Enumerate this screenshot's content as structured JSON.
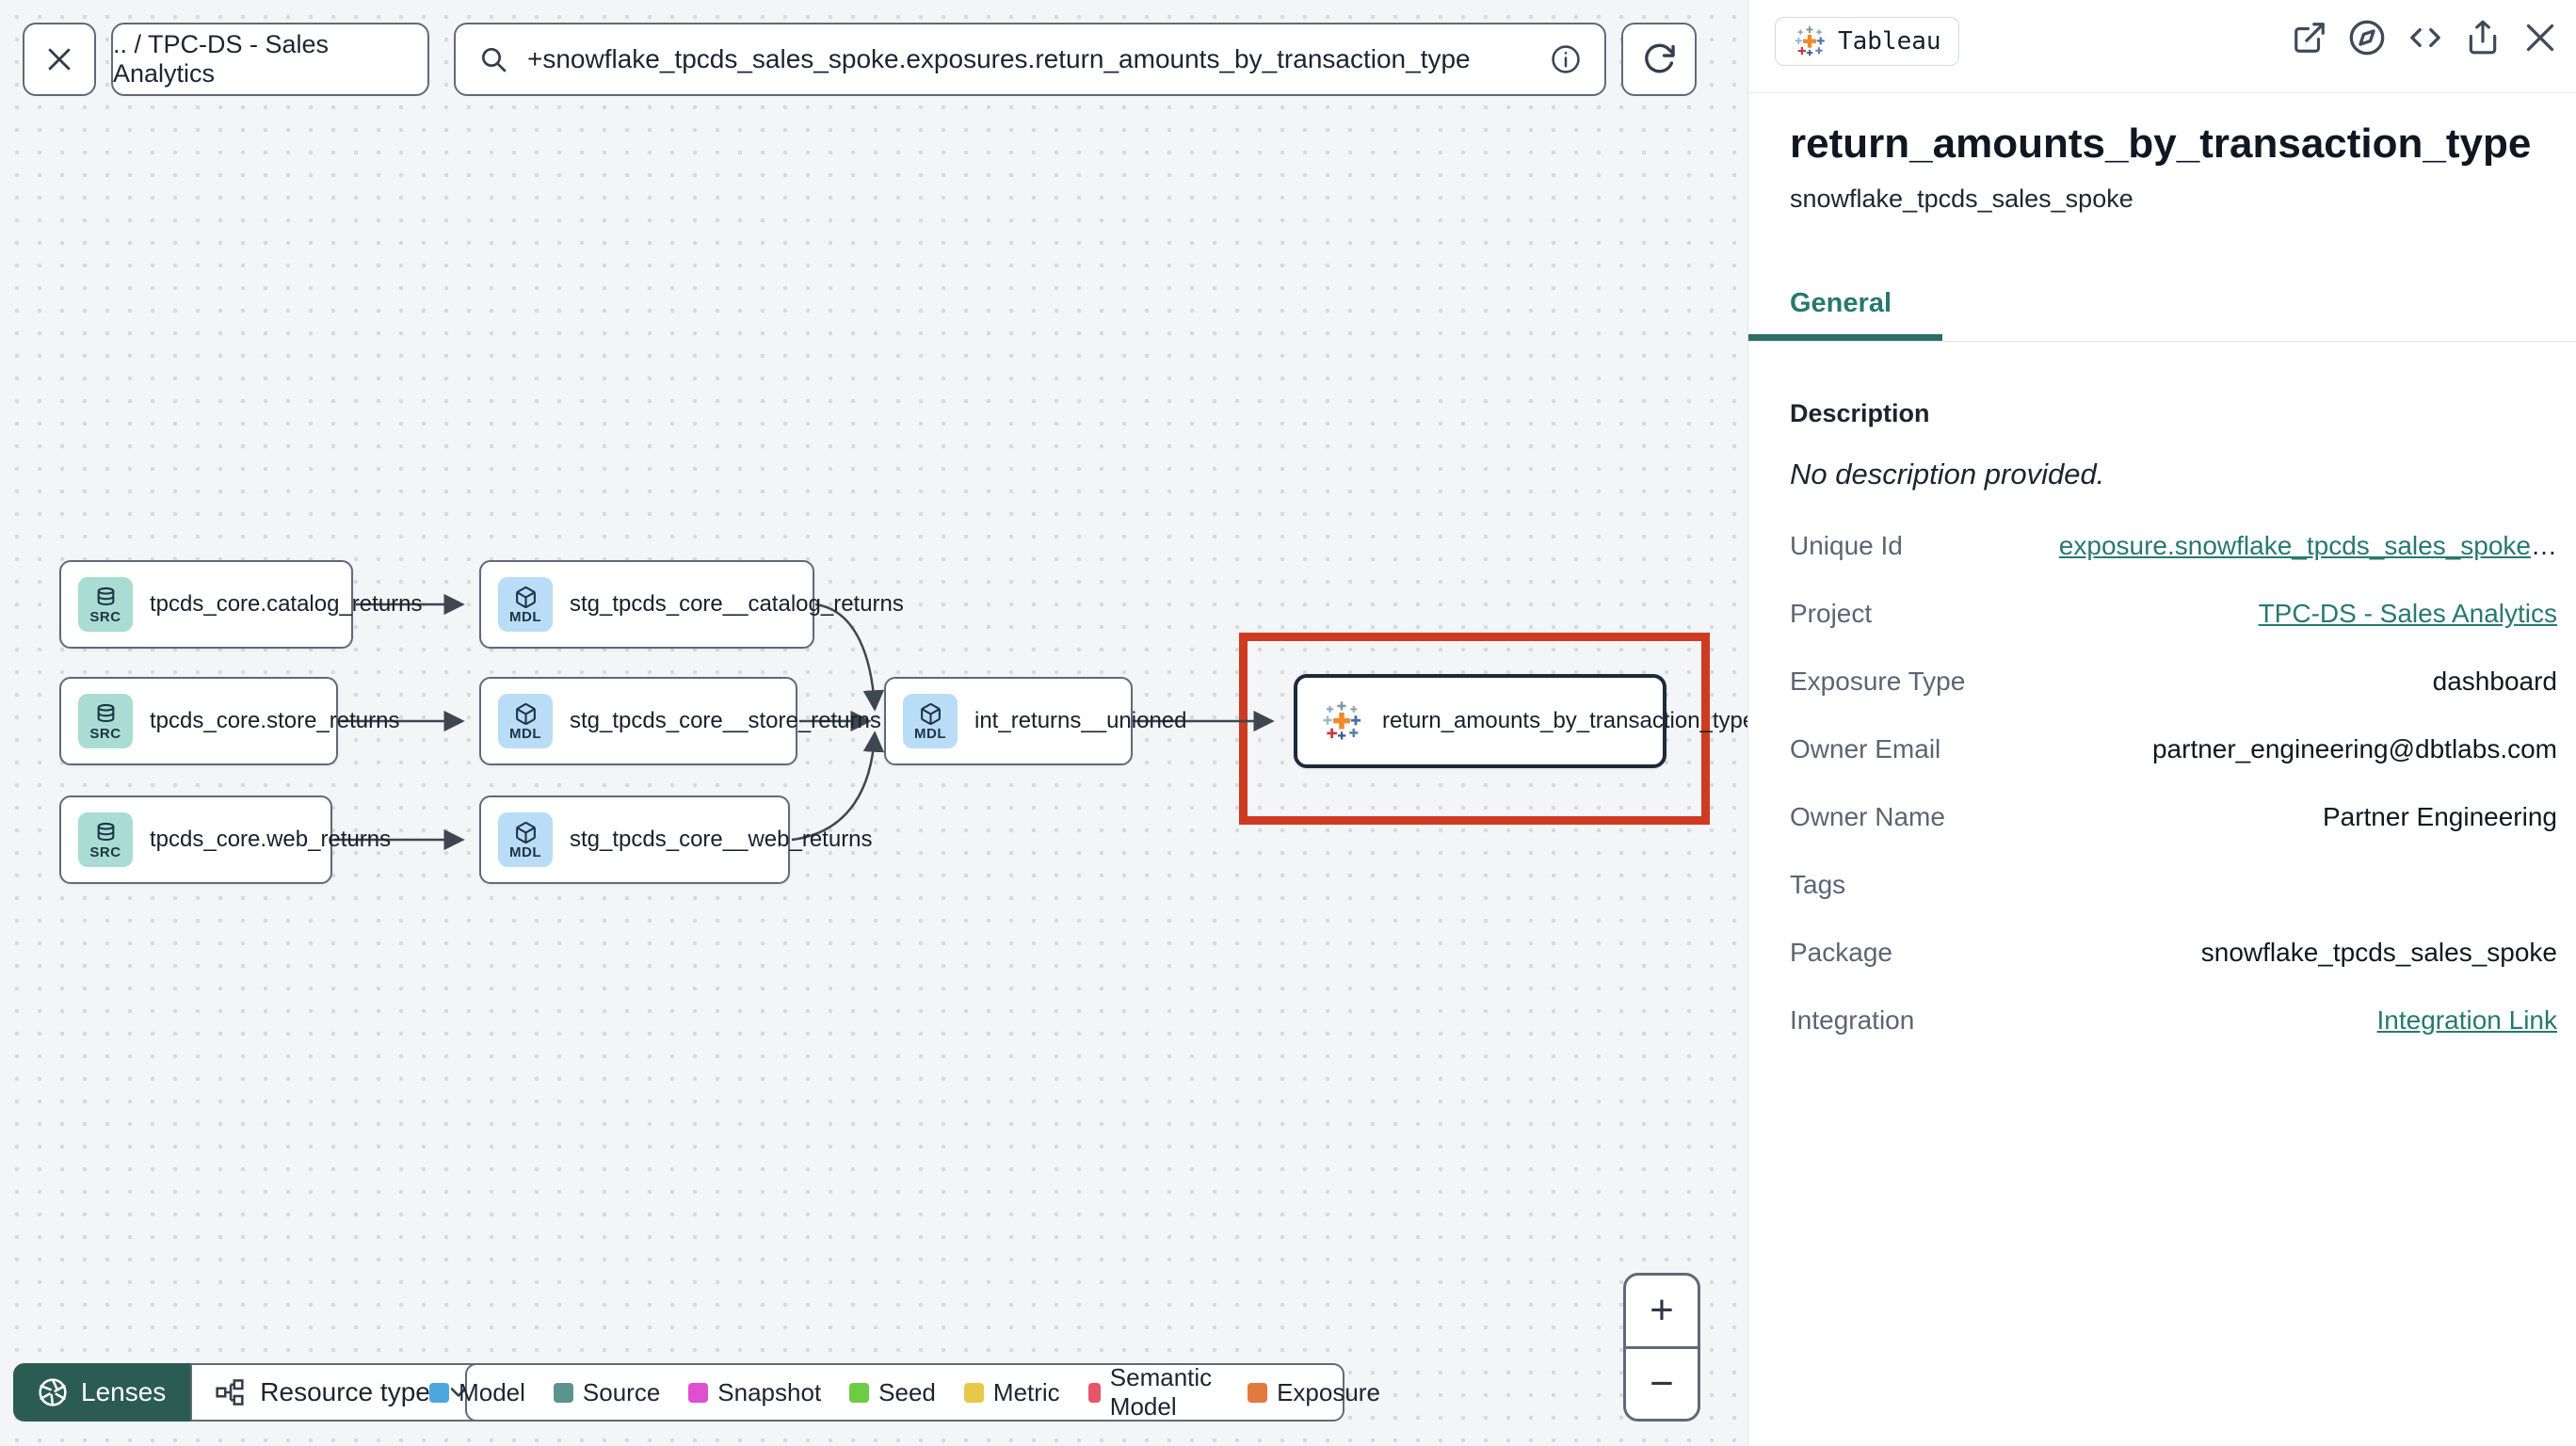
{
  "toolbar": {
    "close_label": "✕",
    "breadcrumb": ".. / TPC-DS - Sales Analytics",
    "search_value": "+snowflake_tpcds_sales_spoke.exposures.return_amounts_by_transaction_type",
    "icons": [
      "search-icon",
      "info-icon",
      "refresh-icon"
    ]
  },
  "graph": {
    "nodes": [
      {
        "type": "source",
        "badge": "SRC",
        "label": "tpcds_core.catalog_returns"
      },
      {
        "type": "source",
        "badge": "SRC",
        "label": "tpcds_core.store_returns"
      },
      {
        "type": "source",
        "badge": "SRC",
        "label": "tpcds_core.web_returns"
      },
      {
        "type": "model",
        "badge": "MDL",
        "label": "stg_tpcds_core__catalog_returns"
      },
      {
        "type": "model",
        "badge": "MDL",
        "label": "stg_tpcds_core__store_returns"
      },
      {
        "type": "model",
        "badge": "MDL",
        "label": "stg_tpcds_core__web_returns"
      },
      {
        "type": "model",
        "badge": "MDL",
        "label": "int_returns__unioned"
      },
      {
        "type": "exposure",
        "badge": "tableau-logo",
        "label": "return_amounts_by_transaction_type",
        "selected": true
      }
    ],
    "highlight_color": "#ce3b22"
  },
  "controls": {
    "lenses_label": "Lenses",
    "resource_type_label": "Resource type",
    "zoom_in": "+",
    "zoom_out": "−"
  },
  "legend": {
    "items": [
      {
        "label": "Model",
        "color": "#4da6e0"
      },
      {
        "label": "Source",
        "color": "#5b948f"
      },
      {
        "label": "Snapshot",
        "color": "#e04fd1"
      },
      {
        "label": "Seed",
        "color": "#6ccc44"
      },
      {
        "label": "Metric",
        "color": "#e8c84a"
      },
      {
        "label": "Semantic Model",
        "color": "#e5566b"
      },
      {
        "label": "Exposure",
        "color": "#e2793f"
      }
    ]
  },
  "panel": {
    "integration_chip": "Tableau",
    "header_icons": [
      "open-in-new-icon",
      "compass-icon",
      "code-icon",
      "share-icon",
      "close-icon"
    ],
    "title": "return_amounts_by_transaction_type",
    "subtitle": "snowflake_tpcds_sales_spoke",
    "tabs": [
      {
        "label": "General",
        "active": true
      }
    ],
    "accent_color": "#27796e",
    "description_heading": "Description",
    "description_empty": "No description provided.",
    "fields": [
      {
        "label": "Unique Id",
        "value": "exposure.snowflake_tpcds_sales_spoke",
        "ellipsis": "…",
        "link": true
      },
      {
        "label": "Project",
        "value": "TPC-DS - Sales Analytics",
        "link": true
      },
      {
        "label": "Exposure Type",
        "value": "dashboard"
      },
      {
        "label": "Owner Email",
        "value": "partner_engineering@dbtlabs.com"
      },
      {
        "label": "Owner Name",
        "value": "Partner Engineering"
      },
      {
        "label": "Tags",
        "value": ""
      },
      {
        "label": "Package",
        "value": "snowflake_tpcds_sales_spoke"
      },
      {
        "label": "Integration",
        "value": "Integration Link",
        "link": true
      }
    ]
  }
}
